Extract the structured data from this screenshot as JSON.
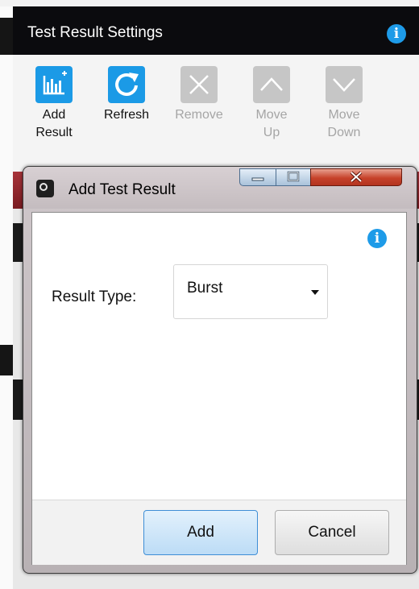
{
  "panel": {
    "title": "Test Result Settings"
  },
  "toolbar": {
    "add": {
      "line1": "Add",
      "line2": "Result",
      "icon": "add-result-icon"
    },
    "refresh": {
      "line1": "Refresh",
      "icon": "refresh-icon"
    },
    "remove": {
      "line1": "Remove",
      "icon": "remove-icon"
    },
    "move_up": {
      "line1": "Move",
      "line2": "Up",
      "icon": "arrow-up-icon"
    },
    "move_down": {
      "line1": "Move",
      "line2": "Down",
      "icon": "arrow-down-icon"
    }
  },
  "dialog": {
    "title": "Add Test Result",
    "field_label": "Result Type:",
    "result_type": "Burst",
    "add_label": "Add",
    "cancel_label": "Cancel"
  },
  "colors": {
    "accent": "#1b9ae6",
    "header_bg": "#0b0b0e",
    "disabled_icon": "#c6c6c6",
    "close_button": "#c6422a"
  }
}
